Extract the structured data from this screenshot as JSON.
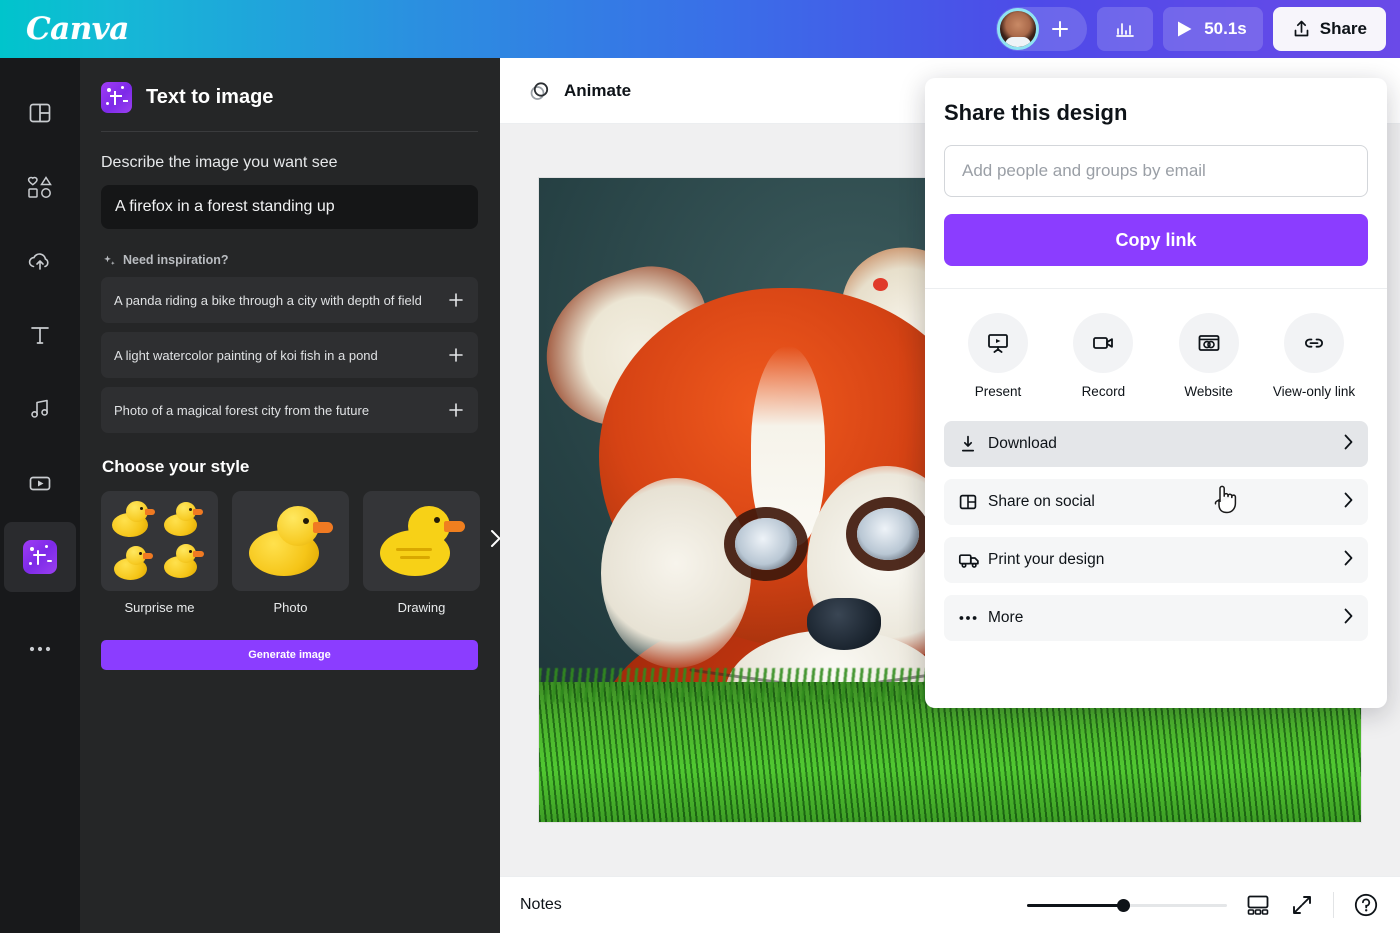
{
  "topbar": {
    "brand": "Canva",
    "avatar_name": "user-avatar",
    "add_member_icon": "plus-icon",
    "analytics_icon": "bar-chart-icon",
    "play_icon": "play-icon",
    "duration": "50.1s",
    "share_icon": "share-upload-icon",
    "share_label": "Share"
  },
  "rail": {
    "items": [
      {
        "name": "design",
        "icon": "layout-panel-icon"
      },
      {
        "name": "elements",
        "icon": "shapes-icon"
      },
      {
        "name": "uploads",
        "icon": "cloud-upload-icon"
      },
      {
        "name": "text",
        "icon": "text-t-icon"
      },
      {
        "name": "audio",
        "icon": "music-note-icon"
      },
      {
        "name": "videos",
        "icon": "video-play-icon"
      },
      {
        "name": "text-to-image",
        "icon": "text-to-image-app-icon",
        "active": true
      },
      {
        "name": "more",
        "icon": "ellipsis-icon"
      }
    ]
  },
  "panel": {
    "title": "Text to image",
    "app_icon": "text-to-image-app-icon",
    "describe_label": "Describe the image you want see",
    "prompt_value": "A firefox in a forest standing up",
    "prompt_placeholder": "Describe the image you want see",
    "inspiration_icon": "sparkle-icon",
    "inspiration_label": "Need inspiration?",
    "suggestions": [
      {
        "text": "A panda riding a bike through a city with depth of field",
        "add_icon": "plus-icon"
      },
      {
        "text": "A light watercolor painting of koi fish in a pond",
        "add_icon": "plus-icon"
      },
      {
        "text": "Photo of a magical forest city from the future",
        "add_icon": "plus-icon"
      }
    ],
    "style_heading": "Choose your style",
    "styles": [
      {
        "label": "Surprise me",
        "thumb": "four-ducks-thumb"
      },
      {
        "label": "Photo",
        "thumb": "photo-duck-thumb"
      },
      {
        "label": "Drawing",
        "thumb": "drawing-duck-thumb"
      }
    ],
    "styles_next_icon": "chevron-right-icon",
    "generate_label": "Generate image"
  },
  "main": {
    "animate_icon": "animate-circles-icon",
    "animate_label": "Animate",
    "artboard_alt": "red-panda-in-grass-image"
  },
  "bottombar": {
    "notes_label": "Notes",
    "zoom_percent": 48,
    "grid_icon": "pages-grid-icon",
    "fullscreen_icon": "expand-arrows-icon",
    "help_icon": "question-circle-icon"
  },
  "share_dialog": {
    "title": "Share this design",
    "email_placeholder": "Add people and groups by email",
    "email_value": "",
    "copy_link_label": "Copy link",
    "quick_actions": [
      {
        "label": "Present",
        "icon": "present-screen-icon"
      },
      {
        "label": "Record",
        "icon": "video-camera-icon"
      },
      {
        "label": "Website",
        "icon": "website-window-icon"
      },
      {
        "label": "View-only link",
        "icon": "link-chain-icon"
      }
    ],
    "menu_items": [
      {
        "label": "Download",
        "icon": "download-icon",
        "chevron": "chevron-right-icon",
        "hovered": true
      },
      {
        "label": "Share on social",
        "icon": "social-panel-icon",
        "chevron": "chevron-right-icon",
        "hovered": false
      },
      {
        "label": "Print your design",
        "icon": "delivery-truck-icon",
        "chevron": "chevron-right-icon",
        "hovered": false
      },
      {
        "label": "More",
        "icon": "ellipsis-icon",
        "chevron": "chevron-right-icon",
        "hovered": false
      }
    ]
  },
  "colors": {
    "brand_purple": "#8b3dff",
    "topbar_start": "#00c4cc",
    "topbar_end": "#6a4ae8",
    "panel_bg": "#252627",
    "rail_bg": "#18191b"
  }
}
